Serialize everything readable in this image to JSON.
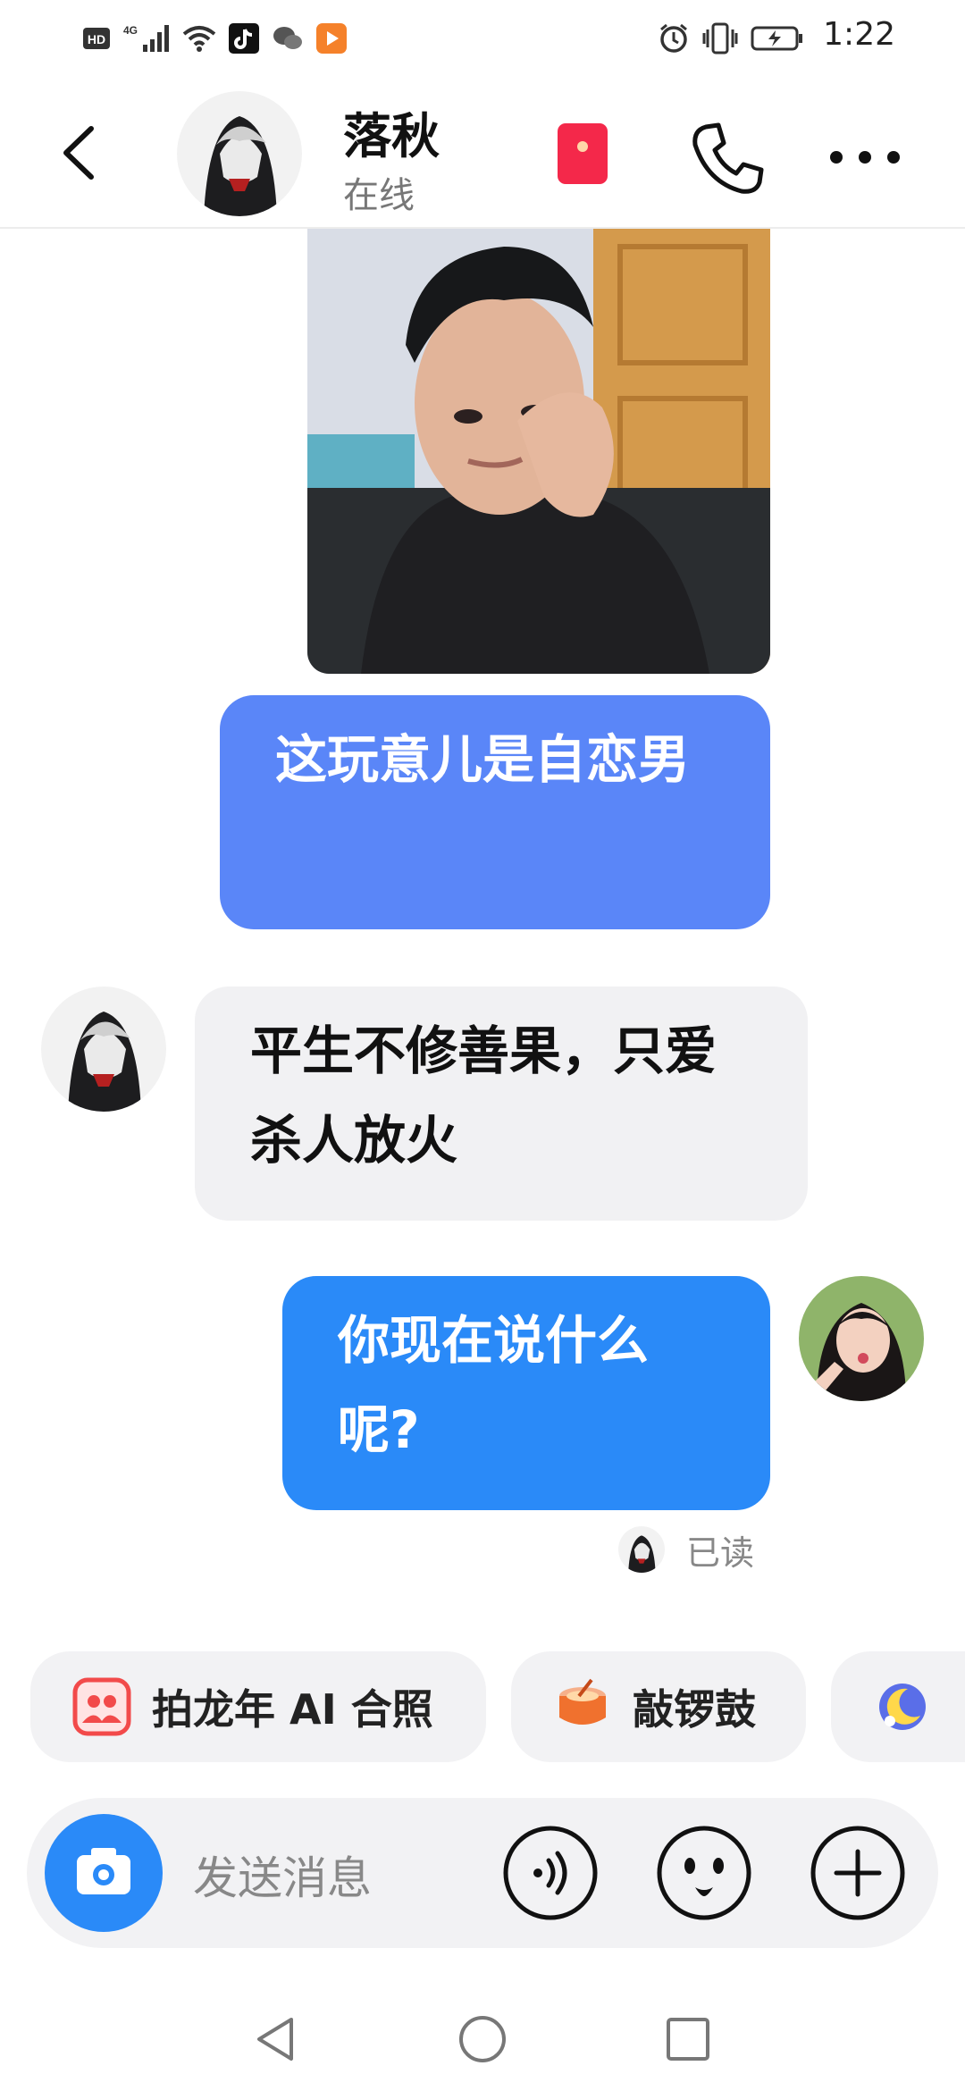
{
  "status_bar": {
    "time": "1:22",
    "left_icons": [
      "hd-icon",
      "4g-signal-icon",
      "wifi-icon",
      "tiktok-icon",
      "wechat-icon",
      "video-app-icon"
    ],
    "right_icons": [
      "alarm-icon",
      "vibrate-icon",
      "battery-charging-icon"
    ]
  },
  "header": {
    "name": "落秋",
    "status": "在线"
  },
  "messages": [
    {
      "type": "image",
      "side": "right"
    },
    {
      "type": "text",
      "side": "right",
      "text": "这玩意儿是自恋男"
    },
    {
      "type": "text",
      "side": "left",
      "text": "平生不修善果，只爱杀人放火"
    },
    {
      "type": "text",
      "side": "right",
      "text": "你现在说什么呢?"
    }
  ],
  "read_status": "已读",
  "quick_actions": [
    {
      "label": "拍龙年 AI 合照",
      "icon": "group-photo-icon"
    },
    {
      "label": "敲锣鼓",
      "icon": "drum-icon"
    },
    {
      "label": "",
      "icon": "moon-icon"
    }
  ],
  "input": {
    "placeholder": "发送消息"
  },
  "colors": {
    "bubble_light_blue": "#5a86f8",
    "bubble_blue": "#2a8af8",
    "bubble_gray": "#f1f1f3",
    "red_packet": "#f4284a"
  }
}
